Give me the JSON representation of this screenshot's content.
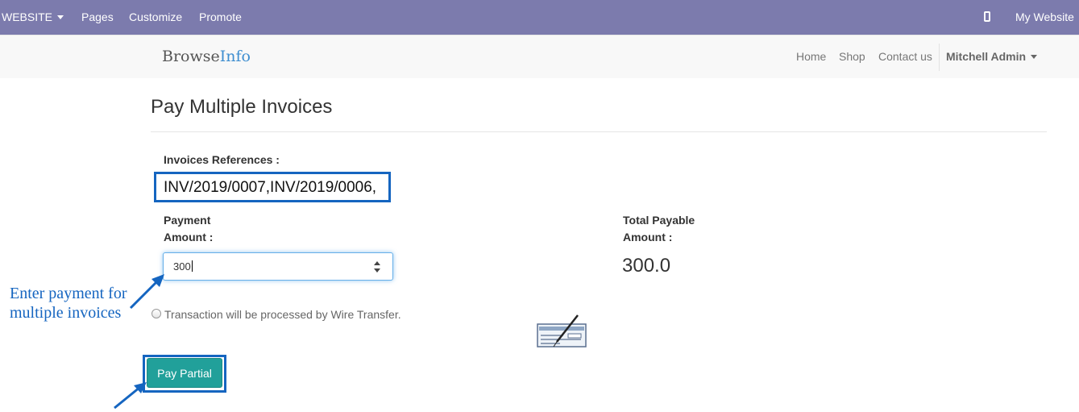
{
  "admin_bar": {
    "website_menu": "WEBSITE",
    "pages": "Pages",
    "customize": "Customize",
    "promote": "Promote",
    "my_website": "My Website",
    "mobile_icon": "mobile-phone-icon"
  },
  "navbar": {
    "logo_part1": "Browse",
    "logo_part2": "Info",
    "links": [
      "Home",
      "Shop",
      "Contact us"
    ],
    "user": "Mitchell Admin"
  },
  "page": {
    "title": "Pay Multiple Invoices",
    "invoices_label": "Invoices References :",
    "invoices_value": "INV/2019/0007,INV/2019/0006,",
    "payment_label_line1": "Payment",
    "payment_label_line2": "Amount :",
    "payment_value": "300",
    "total_label_line1": "Total Payable",
    "total_label_line2": "Amount :",
    "total_value": "300.0",
    "radio_label": "Transaction will be processed by Wire Transfer.",
    "pay_button": "Pay Partial"
  },
  "annotation": {
    "line1": "Enter payment for",
    "line2": "multiple invoices"
  },
  "colors": {
    "admin_bar": "#7c7bad",
    "highlight": "#1565c0",
    "button": "#21a09a",
    "logo_accent": "#3e8ed0"
  }
}
